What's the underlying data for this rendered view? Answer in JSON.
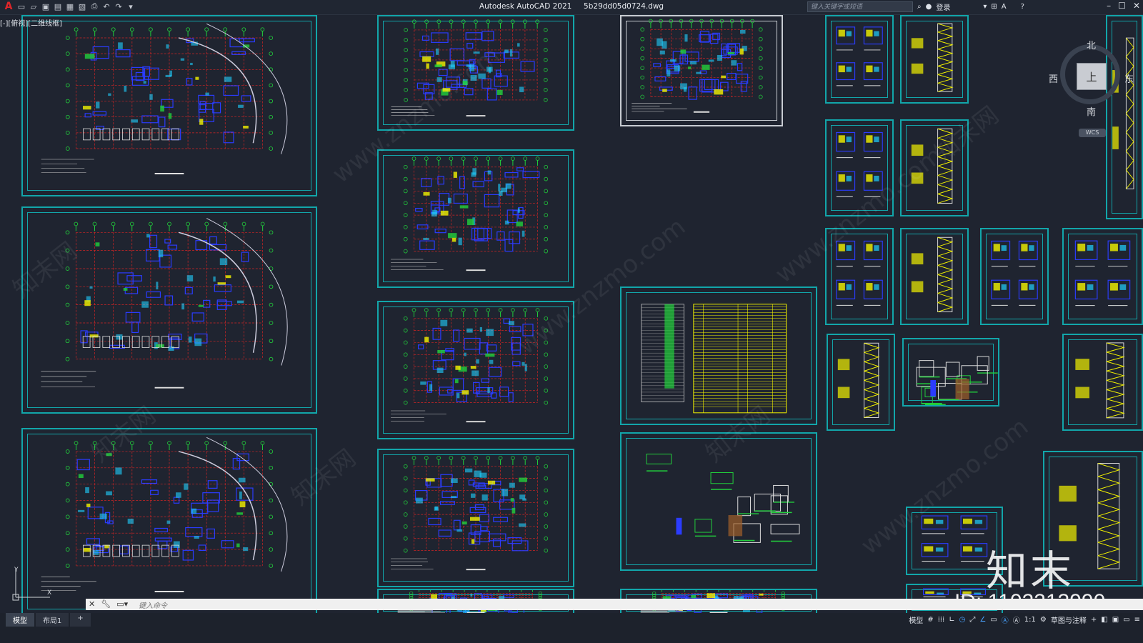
{
  "window": {
    "app_title": "Autodesk AutoCAD 2021",
    "file_name": "5b29dd05d0724.dwg",
    "search_placeholder": "键入关键字或短语",
    "login_label": "登录",
    "view_label": "[-][俯视][二维线框]"
  },
  "viewcube": {
    "north": "北",
    "south": "南",
    "west": "西",
    "east": "东",
    "face": "上",
    "wcs": "WCS"
  },
  "command_line": {
    "placeholder": "键入命令"
  },
  "layout_tabs": [
    "模型",
    "布局1",
    "+"
  ],
  "status_bar": {
    "model_label": "模型",
    "scale": "1:1",
    "workspace": "草图与注释"
  },
  "watermark": {
    "brand": "知末",
    "id": "ID: 1102213990",
    "site": "www.znzmo.com",
    "tile": "知末网"
  },
  "colors": {
    "background": "#1f2430",
    "frame_cyan": "#12a6aa",
    "red_grid": "#d42424",
    "green_dims": "#22d13c",
    "blue_walls": "#2b3cff",
    "yellow": "#f2f200"
  },
  "icons": [
    "autocad-logo-icon",
    "new-icon",
    "open-icon",
    "save-icon",
    "saveas-icon",
    "print-icon",
    "undo-icon",
    "redo-icon",
    "search-icon",
    "user-icon",
    "cart-icon",
    "help-icon",
    "minimize-icon",
    "maximize-icon",
    "close-icon"
  ]
}
